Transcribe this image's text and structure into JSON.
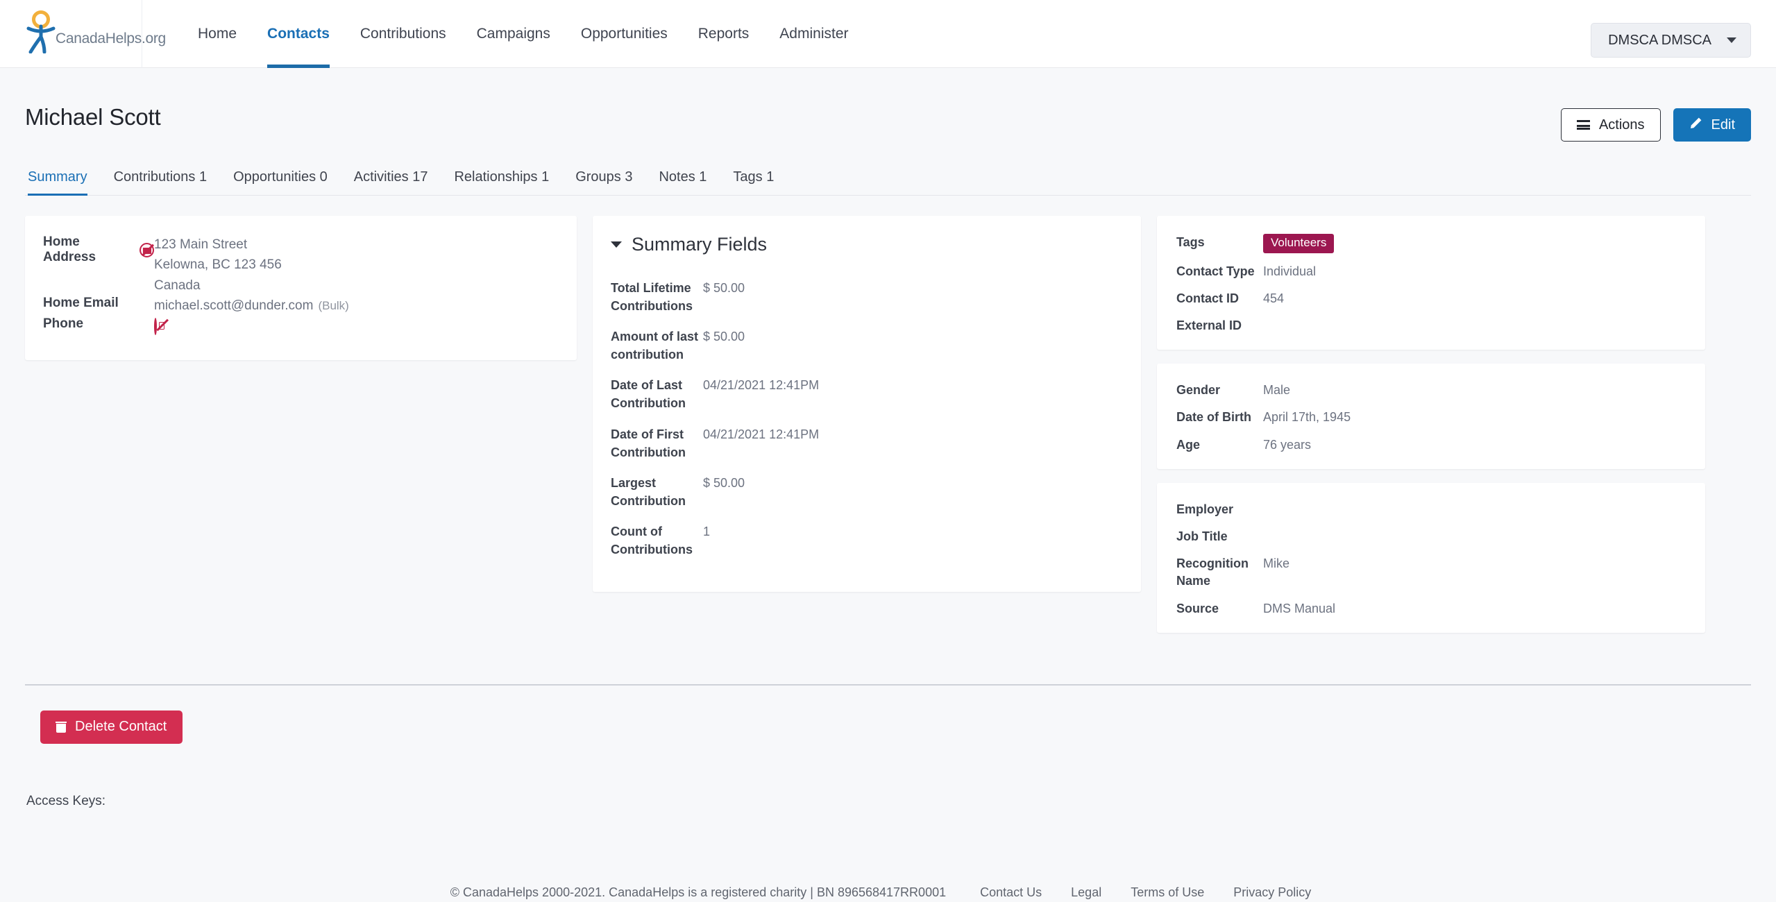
{
  "brand": {
    "wordmark": "CanadaHelps.org",
    "logo_icon": "canadahelps-person-logo"
  },
  "nav": {
    "items": [
      {
        "label": "Home",
        "active": false
      },
      {
        "label": "Contacts",
        "active": true
      },
      {
        "label": "Contributions",
        "active": false
      },
      {
        "label": "Campaigns",
        "active": false
      },
      {
        "label": "Opportunities",
        "active": false
      },
      {
        "label": "Reports",
        "active": false
      },
      {
        "label": "Administer",
        "active": false
      }
    ],
    "user_menu_label": "DMSCA DMSCA"
  },
  "page": {
    "title": "Michael Scott",
    "actions_label": "Actions",
    "edit_label": "Edit"
  },
  "tabs": [
    {
      "label": "Summary",
      "active": true
    },
    {
      "label": "Contributions 1",
      "active": false
    },
    {
      "label": "Opportunities 0",
      "active": false
    },
    {
      "label": "Activities 17",
      "active": false
    },
    {
      "label": "Relationships 1",
      "active": false
    },
    {
      "label": "Groups 3",
      "active": false
    },
    {
      "label": "Notes 1",
      "active": false
    },
    {
      "label": "Tags 1",
      "active": false
    }
  ],
  "contact_card": {
    "address_label": "Home Address",
    "address_lines": [
      "123 Main Street",
      "Kelowna, BC 123 456",
      "Canada"
    ],
    "email_label": "Home Email",
    "email_value": "michael.scott@dunder.com",
    "email_suffix": "(Bulk)",
    "phone_label": "Phone"
  },
  "summary_fields": {
    "title": "Summary Fields",
    "rows": [
      {
        "label": "Total Lifetime Contributions",
        "value": "$ 50.00"
      },
      {
        "label": "Amount of last contribution",
        "value": "$ 50.00"
      },
      {
        "label": "Date of Last Contribution",
        "value": "04/21/2021 12:41PM"
      },
      {
        "label": "Date of First Contribution",
        "value": "04/21/2021 12:41PM"
      },
      {
        "label": "Largest Contribution",
        "value": "$ 50.00"
      },
      {
        "label": "Count of Contributions",
        "value": "1"
      }
    ]
  },
  "info_identity": {
    "tags_label": "Tags",
    "tags_value": "Volunteers",
    "tags_color": "#9c1750",
    "rows": [
      {
        "label": "Contact Type",
        "value": "Individual"
      },
      {
        "label": "Contact ID",
        "value": "454"
      },
      {
        "label": "External ID",
        "value": ""
      }
    ]
  },
  "info_demographics": {
    "rows": [
      {
        "label": "Gender",
        "value": "Male"
      },
      {
        "label": "Date of Birth",
        "value": "April 17th, 1945"
      },
      {
        "label": "Age",
        "value": "76 years"
      }
    ]
  },
  "info_employment": {
    "rows": [
      {
        "label": "Employer",
        "value": ""
      },
      {
        "label": "Job Title",
        "value": ""
      },
      {
        "label": "Recognition Name",
        "value": "Mike"
      },
      {
        "label": "Source",
        "value": "DMS Manual"
      }
    ]
  },
  "delete": {
    "label": "Delete Contact",
    "color": "#d32e51"
  },
  "access_keys": {
    "label": "Access Keys:"
  },
  "footer": {
    "copyright": "© CanadaHelps 2000-2021. CanadaHelps is a registered charity | BN 896568417RR0001",
    "links": [
      "Contact Us",
      "Legal",
      "Terms of Use",
      "Privacy Policy"
    ]
  }
}
